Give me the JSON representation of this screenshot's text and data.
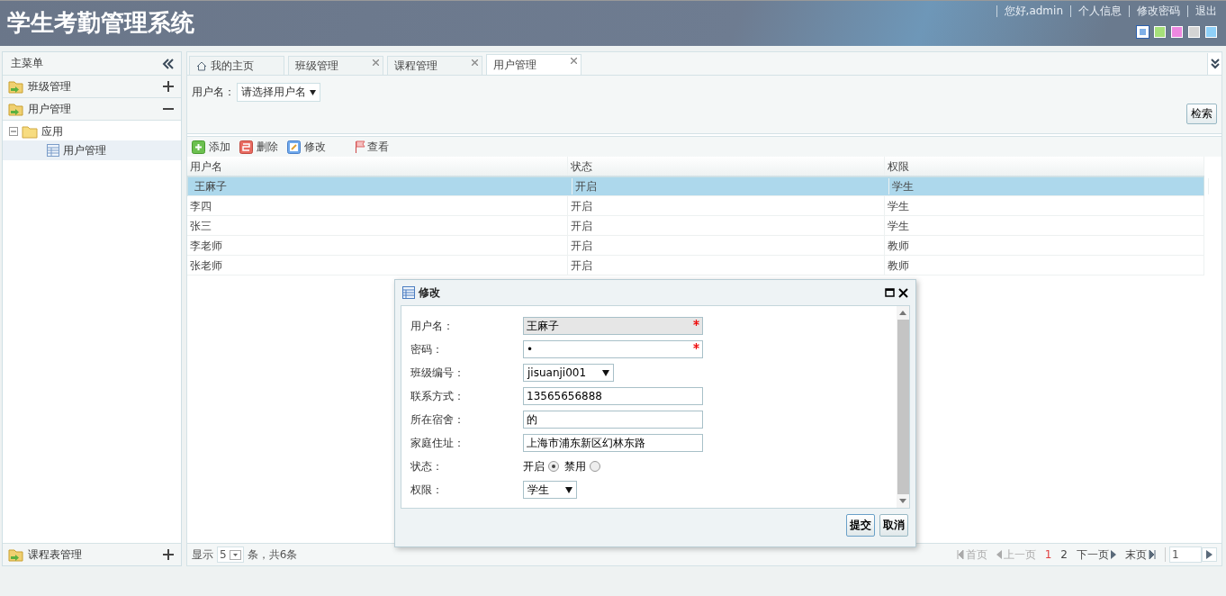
{
  "header": {
    "title": "学生考勤管理系统",
    "links": [
      "您好,admin",
      "个人信息",
      "修改密码",
      "退出"
    ],
    "themes": [
      {
        "color": "#7fb0e8",
        "selected": true
      },
      {
        "color": "#a6e07a",
        "selected": false
      },
      {
        "color": "#ee88e0",
        "selected": false
      },
      {
        "color": "#d4d4d4",
        "selected": false
      },
      {
        "color": "#8fd0f8",
        "selected": false
      }
    ]
  },
  "sidebar": {
    "title": "主菜单",
    "sections": [
      {
        "label": "班级管理",
        "expanded": false
      },
      {
        "label": "用户管理",
        "expanded": true,
        "tree": [
          {
            "label": "应用",
            "expanded": true,
            "children": [
              {
                "label": "用户管理",
                "selected": true
              }
            ]
          }
        ]
      }
    ],
    "bottom_section": {
      "label": "课程表管理",
      "expanded": false
    }
  },
  "tabs": [
    {
      "label": "我的主页",
      "selected": false,
      "closable": false
    },
    {
      "label": "班级管理",
      "selected": false,
      "closable": true
    },
    {
      "label": "课程管理",
      "selected": false,
      "closable": true
    },
    {
      "label": "用户管理",
      "selected": true,
      "closable": true
    }
  ],
  "search": {
    "label": "用户名：",
    "select": "请选择用户名",
    "button": "检索"
  },
  "toolbar": [
    {
      "kind": "add",
      "label": "添加"
    },
    {
      "kind": "delete",
      "label": "删除"
    },
    {
      "kind": "edit",
      "label": "修改"
    },
    {
      "kind": "view",
      "label": "查看"
    }
  ],
  "table": {
    "columns": [
      "用户名",
      "状态",
      "权限"
    ],
    "rows": [
      {
        "cells": [
          "王麻子",
          "开启",
          "学生"
        ],
        "selected": true
      },
      {
        "cells": [
          "李四",
          "开启",
          "学生"
        ],
        "selected": false
      },
      {
        "cells": [
          "张三",
          "开启",
          "学生"
        ],
        "selected": false
      },
      {
        "cells": [
          "李老师",
          "开启",
          "教师"
        ],
        "selected": false
      },
      {
        "cells": [
          "张老师",
          "开启",
          "教师"
        ],
        "selected": false
      }
    ]
  },
  "pager": {
    "show": "显示",
    "page_size": "5",
    "summary": "条，共6条",
    "first": "首页",
    "prev": "上一页",
    "pages": [
      {
        "label": "1",
        "selected": true
      },
      {
        "label": "2",
        "selected": false
      }
    ],
    "next": "下一页",
    "last": "末页",
    "goto": "1",
    "first_disabled": true
  },
  "dialog": {
    "title": "修改",
    "fields": [
      {
        "kind": "text",
        "label": "用户名：",
        "value": "王麻子",
        "required": true,
        "readonly": true
      },
      {
        "kind": "text",
        "label": "密码：",
        "value": "•",
        "required": true,
        "readonly": false
      },
      {
        "kind": "select",
        "label": "班级编号：",
        "value": "jisuanji001"
      },
      {
        "kind": "text",
        "label": "联系方式：",
        "value": "13565656888",
        "required": false,
        "readonly": false
      },
      {
        "kind": "text",
        "label": "所在宿舍：",
        "value": "的",
        "required": false,
        "readonly": false
      },
      {
        "kind": "text",
        "label": "家庭住址：",
        "value": "上海市浦东新区幻林东路",
        "required": false,
        "readonly": false
      },
      {
        "kind": "radio",
        "label": "状态：",
        "options": [
          {
            "label": "开启",
            "selected": true
          },
          {
            "label": "禁用",
            "selected": false
          }
        ]
      },
      {
        "kind": "select",
        "label": "权限：",
        "value": "学生"
      }
    ],
    "buttons": [
      "提交",
      "取消"
    ]
  }
}
